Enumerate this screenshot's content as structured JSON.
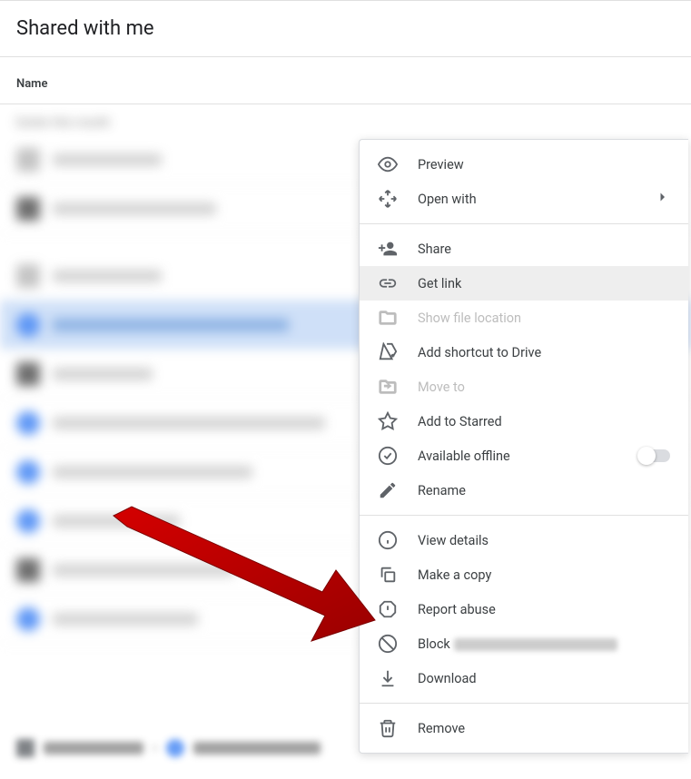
{
  "page": {
    "title": "Shared with me",
    "column_header": "Name"
  },
  "background": {
    "group_label": "Earlier this month",
    "breadcrumb_label": "Shared with me"
  },
  "context_menu": {
    "items": [
      {
        "id": "preview",
        "label": "Preview",
        "icon": "eye-icon"
      },
      {
        "id": "open-with",
        "label": "Open with",
        "icon": "open-with-icon",
        "submenu": true
      }
    ],
    "items2": [
      {
        "id": "share",
        "label": "Share",
        "icon": "person-add-icon"
      },
      {
        "id": "get-link",
        "label": "Get link",
        "icon": "link-icon",
        "hovered": true
      },
      {
        "id": "show-location",
        "label": "Show file location",
        "icon": "folder-icon",
        "disabled": true
      },
      {
        "id": "add-shortcut",
        "label": "Add shortcut to Drive",
        "icon": "drive-shortcut-icon"
      },
      {
        "id": "move-to",
        "label": "Move to",
        "icon": "move-icon",
        "disabled": true
      },
      {
        "id": "starred",
        "label": "Add to Starred",
        "icon": "star-icon"
      },
      {
        "id": "offline",
        "label": "Available offline",
        "icon": "offline-icon",
        "toggle": true,
        "toggle_on": false
      },
      {
        "id": "rename",
        "label": "Rename",
        "icon": "edit-icon"
      }
    ],
    "items3": [
      {
        "id": "view-details",
        "label": "View details",
        "icon": "info-icon"
      },
      {
        "id": "make-copy",
        "label": "Make a copy",
        "icon": "copy-icon"
      },
      {
        "id": "report-abuse",
        "label": "Report abuse",
        "icon": "report-icon"
      },
      {
        "id": "block",
        "label": "Block",
        "icon": "block-icon",
        "blurred_suffix": true
      },
      {
        "id": "download",
        "label": "Download",
        "icon": "download-icon"
      }
    ],
    "items4": [
      {
        "id": "remove",
        "label": "Remove",
        "icon": "trash-icon"
      }
    ]
  },
  "colors": {
    "text_primary": "#3c4043",
    "text_disabled": "#bdbdbd",
    "hover_bg": "#eeeeee",
    "arrow": "#c00000"
  }
}
